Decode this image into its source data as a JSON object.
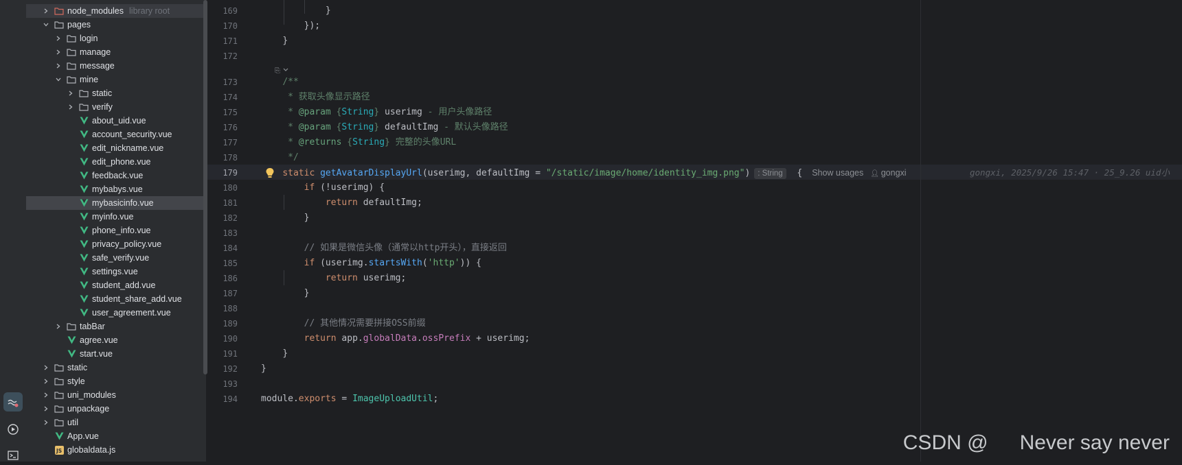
{
  "activity_bar": {
    "items": [
      {
        "name": "ai-assistant-icon",
        "active": true
      },
      {
        "name": "run-icon",
        "active": false
      },
      {
        "name": "terminal-icon",
        "active": false
      }
    ]
  },
  "project_tree": {
    "items": [
      {
        "label": "node_modules",
        "extra": "library root",
        "depth": 1,
        "expanded": false,
        "type": "folder-excluded",
        "selected": true
      },
      {
        "label": "pages",
        "depth": 1,
        "expanded": true,
        "type": "folder"
      },
      {
        "label": "login",
        "depth": 2,
        "expanded": false,
        "type": "folder"
      },
      {
        "label": "manage",
        "depth": 2,
        "expanded": false,
        "type": "folder"
      },
      {
        "label": "message",
        "depth": 2,
        "expanded": false,
        "type": "folder"
      },
      {
        "label": "mine",
        "depth": 2,
        "expanded": true,
        "type": "folder"
      },
      {
        "label": "static",
        "depth": 3,
        "expanded": false,
        "type": "folder"
      },
      {
        "label": "verify",
        "depth": 3,
        "expanded": false,
        "type": "folder"
      },
      {
        "label": "about_uid.vue",
        "depth": 3,
        "type": "vue"
      },
      {
        "label": "account_security.vue",
        "depth": 3,
        "type": "vue"
      },
      {
        "label": "edit_nickname.vue",
        "depth": 3,
        "type": "vue"
      },
      {
        "label": "edit_phone.vue",
        "depth": 3,
        "type": "vue"
      },
      {
        "label": "feedback.vue",
        "depth": 3,
        "type": "vue"
      },
      {
        "label": "mybabys.vue",
        "depth": 3,
        "type": "vue"
      },
      {
        "label": "mybasicinfo.vue",
        "depth": 3,
        "type": "vue",
        "highlighted": true
      },
      {
        "label": "myinfo.vue",
        "depth": 3,
        "type": "vue"
      },
      {
        "label": "phone_info.vue",
        "depth": 3,
        "type": "vue"
      },
      {
        "label": "privacy_policy.vue",
        "depth": 3,
        "type": "vue"
      },
      {
        "label": "safe_verify.vue",
        "depth": 3,
        "type": "vue"
      },
      {
        "label": "settings.vue",
        "depth": 3,
        "type": "vue"
      },
      {
        "label": "student_add.vue",
        "depth": 3,
        "type": "vue"
      },
      {
        "label": "student_share_add.vue",
        "depth": 3,
        "type": "vue"
      },
      {
        "label": "user_agreement.vue",
        "depth": 3,
        "type": "vue"
      },
      {
        "label": "tabBar",
        "depth": 2,
        "expanded": false,
        "type": "folder"
      },
      {
        "label": "agree.vue",
        "depth": 2,
        "type": "vue"
      },
      {
        "label": "start.vue",
        "depth": 2,
        "type": "vue"
      },
      {
        "label": "static",
        "depth": 1,
        "expanded": false,
        "type": "folder"
      },
      {
        "label": "style",
        "depth": 1,
        "expanded": false,
        "type": "folder"
      },
      {
        "label": "uni_modules",
        "depth": 1,
        "expanded": false,
        "type": "folder"
      },
      {
        "label": "unpackage",
        "depth": 1,
        "expanded": false,
        "type": "folder"
      },
      {
        "label": "util",
        "depth": 1,
        "expanded": false,
        "type": "folder"
      },
      {
        "label": "App.vue",
        "depth": 1,
        "type": "vue"
      },
      {
        "label": "globaldata.js",
        "depth": 1,
        "type": "js"
      }
    ]
  },
  "editor": {
    "inlay_type": ": String",
    "show_usages": "Show usages",
    "author_hint": "gongxi",
    "blame": "gongxi, 2025/9/26 15:47 · 25_9.26 uid小",
    "lines": [
      {
        "n": "169",
        "segs": [
          [
            "            ",
            ""
          ],
          [
            "}",
            "p"
          ]
        ]
      },
      {
        "n": "170",
        "segs": [
          [
            "        ",
            ""
          ],
          [
            "});",
            "p"
          ]
        ]
      },
      {
        "n": "171",
        "segs": [
          [
            "    ",
            ""
          ],
          [
            "}",
            "p"
          ]
        ]
      },
      {
        "n": "172",
        "segs": []
      },
      {
        "n": "173",
        "segs": [
          [
            "    ",
            ""
          ],
          [
            "/**",
            "doc"
          ]
        ]
      },
      {
        "n": "174",
        "segs": [
          [
            "     * 获取头像显示路径",
            "doc"
          ]
        ]
      },
      {
        "n": "175",
        "segs": [
          [
            "     * ",
            "doc"
          ],
          [
            "@param",
            "tag"
          ],
          [
            " {",
            "doc"
          ],
          [
            "String",
            "typ"
          ],
          [
            "} ",
            "doc"
          ],
          [
            "userimg",
            "p"
          ],
          [
            " - 用户头像路径",
            "doc"
          ]
        ]
      },
      {
        "n": "176",
        "segs": [
          [
            "     * ",
            "doc"
          ],
          [
            "@param",
            "tag"
          ],
          [
            " {",
            "doc"
          ],
          [
            "String",
            "typ"
          ],
          [
            "} ",
            "doc"
          ],
          [
            "defaultImg",
            "p"
          ],
          [
            " - 默认头像路径",
            "doc"
          ]
        ]
      },
      {
        "n": "177",
        "segs": [
          [
            "     * ",
            "doc"
          ],
          [
            "@returns",
            "tag"
          ],
          [
            " {",
            "doc"
          ],
          [
            "String",
            "typ"
          ],
          [
            "} 完整的头像URL",
            "doc"
          ]
        ]
      },
      {
        "n": "178",
        "segs": [
          [
            "     */",
            "doc"
          ]
        ]
      },
      {
        "n": "179",
        "current": true,
        "segs": [
          [
            "    ",
            ""
          ],
          [
            "static ",
            "kw"
          ],
          [
            "getAvatarDisplayUrl",
            "fn"
          ],
          [
            "(userimg, defaultImg = ",
            "p"
          ],
          [
            "\"/static/image/home/identity_img.png\"",
            "str"
          ],
          [
            ")",
            "p"
          ]
        ]
      },
      {
        "n": "180",
        "segs": [
          [
            "        ",
            ""
          ],
          [
            "if ",
            "kw"
          ],
          [
            "(!userimg) {",
            "p"
          ]
        ]
      },
      {
        "n": "181",
        "segs": [
          [
            "            ",
            ""
          ],
          [
            "return ",
            "kw"
          ],
          [
            "defaultImg;",
            "p"
          ]
        ]
      },
      {
        "n": "182",
        "segs": [
          [
            "        ",
            ""
          ],
          [
            "}",
            "p"
          ]
        ]
      },
      {
        "n": "183",
        "segs": []
      },
      {
        "n": "184",
        "segs": [
          [
            "        ",
            ""
          ],
          [
            "// 如果是微信头像（通常以http开头），直接返回",
            "cm"
          ]
        ]
      },
      {
        "n": "185",
        "segs": [
          [
            "        ",
            ""
          ],
          [
            "if ",
            "kw"
          ],
          [
            "(userimg.",
            "p"
          ],
          [
            "startsWith",
            "fn"
          ],
          [
            "(",
            "p"
          ],
          [
            "'http'",
            "str"
          ],
          [
            ")) {",
            "p"
          ]
        ]
      },
      {
        "n": "186",
        "segs": [
          [
            "            ",
            ""
          ],
          [
            "return ",
            "kw"
          ],
          [
            "userimg;",
            "p"
          ]
        ]
      },
      {
        "n": "187",
        "segs": [
          [
            "        ",
            ""
          ],
          [
            "}",
            "p"
          ]
        ]
      },
      {
        "n": "188",
        "segs": []
      },
      {
        "n": "189",
        "segs": [
          [
            "        ",
            ""
          ],
          [
            "// 其他情况需要拼接OSS前缀",
            "cm"
          ]
        ]
      },
      {
        "n": "190",
        "segs": [
          [
            "        ",
            ""
          ],
          [
            "return ",
            "kw"
          ],
          [
            "app.",
            "p"
          ],
          [
            "globalData",
            "field"
          ],
          [
            ".",
            "p"
          ],
          [
            "ossPrefix",
            "field"
          ],
          [
            " + userimg;",
            "p"
          ]
        ]
      },
      {
        "n": "191",
        "segs": [
          [
            "    ",
            ""
          ],
          [
            "}",
            "p"
          ]
        ]
      },
      {
        "n": "192",
        "segs": [
          [
            "}",
            "p"
          ]
        ]
      },
      {
        "n": "193",
        "segs": []
      },
      {
        "n": "194",
        "segs": [
          [
            "module",
            "p"
          ],
          [
            ".",
            "p"
          ],
          [
            "exports",
            "kw"
          ],
          [
            " = ",
            "p"
          ],
          [
            "ImageUploadUtil",
            "cls"
          ],
          [
            ";",
            "p"
          ]
        ]
      }
    ]
  },
  "watermark": {
    "left": "CSDN @",
    "right": "Never say never"
  }
}
